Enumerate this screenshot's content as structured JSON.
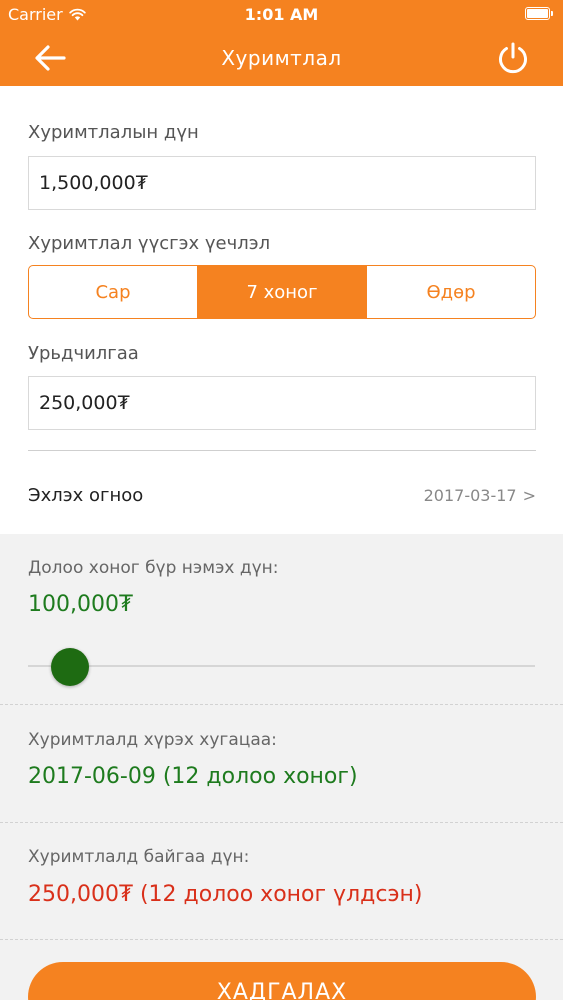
{
  "status_bar": {
    "carrier": "Carrier",
    "time": "1:01 AM"
  },
  "nav": {
    "title": "Хуримтлал",
    "back_icon": "arrow-left-icon",
    "power_icon": "power-icon"
  },
  "form": {
    "amount_label": "Хуримтлалын дүн",
    "amount_value": "1,500,000₮",
    "frequency_label": "Хуримтлал үүсгэх үечлэл",
    "frequency_options": [
      "Сар",
      "7 хоног",
      "Өдөр"
    ],
    "frequency_selected": "7 хоног",
    "advance_label": "Урьдчилгаа",
    "advance_value": "250,000₮",
    "start_date_label": "Эхлэх огноо",
    "start_date_value": "2017-03-17",
    "start_date_chevron": ">"
  },
  "summary": {
    "weekly_add_label": "Долоо хоног бүр нэмэх дүн:",
    "weekly_add_value": "100,000₮",
    "slider_level": 0.05,
    "reach_label": "Хуримтлалд хүрэх хугацаа:",
    "reach_value": "2017-06-09 (12  долоо хоног)",
    "current_label": "Хуримтлалд байгаа дүн:",
    "current_value": "250,000₮ (12  долоо хоног үлдсэн)"
  },
  "actions": {
    "save_label": "ХАДГАЛАХ"
  },
  "colors": {
    "brand_orange": "#F58220",
    "value_green": "#1E7B1E",
    "value_red": "#D9301A",
    "slider_thumb": "#1E6B12"
  }
}
